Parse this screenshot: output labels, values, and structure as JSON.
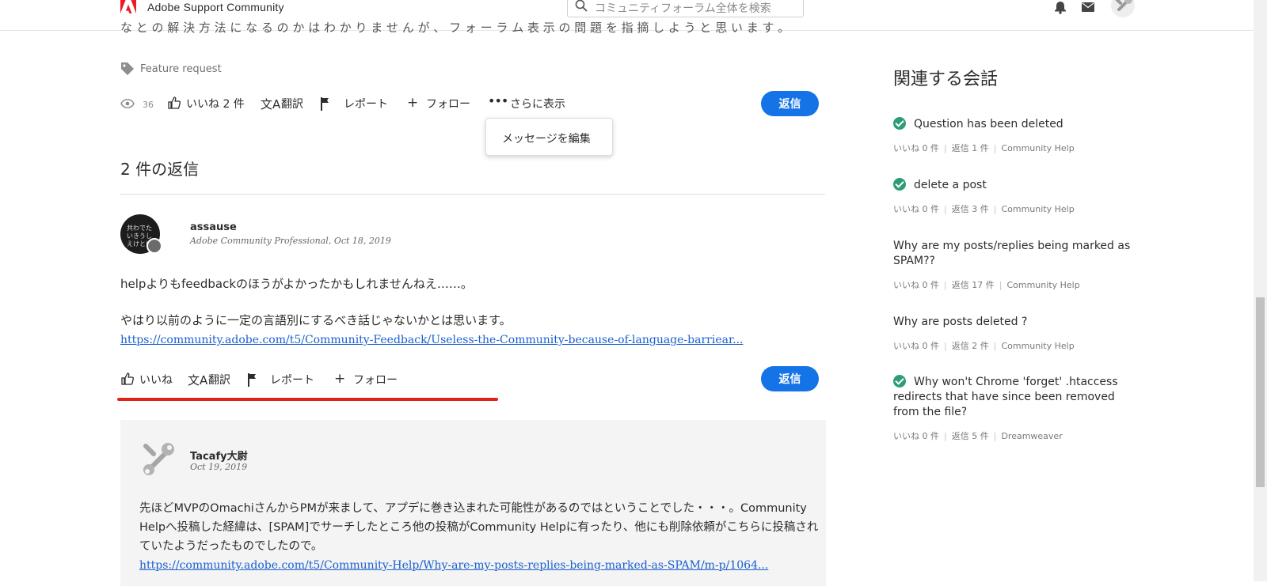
{
  "header": {
    "brand": "Adobe Support Community",
    "search_placeholder": "コミュニティフォーラム全体を検索"
  },
  "post": {
    "tag": "Feature request",
    "views": "36",
    "like_label": "いいね 2 件",
    "translate_label": "翻訳",
    "report_label": "レポート",
    "follow_label": "フォロー",
    "more_label": "さらに表示",
    "reply_label": "返信",
    "dropdown_edit": "メッセージを編集"
  },
  "replies_heading": "2 件の返信",
  "reply1": {
    "user": "assause",
    "meta": "Adobe Community Professional, Oct 18, 2019",
    "line1": "helpよりもfeedbackのほうがよかったかもしれませんねえ……。",
    "line2": "やはり以前のように一定の言語別にするべき話じゃないかとは思います。",
    "link": "https://community.adobe.com/t5/Community-Feedback/Useless-the-Community-because-of-language-barriear...",
    "like_label": "いいね",
    "translate_label": "翻訳",
    "report_label": "レポート",
    "follow_label": "フォロー",
    "reply_label": "返信"
  },
  "reply2": {
    "user": "Tacafy大尉",
    "meta": "Oct 19, 2019",
    "text": "先ほどMVPのOmachiさんからPMが来まして、アプデに巻き込まれた可能性があるのではということでした・・・。Community Helpへ投稿した経緯は、[SPAM]でサーチしたところ他の投稿がCommunity Helpに有ったり、他にも削除依頼がこちらに投稿されていたようだったものでしたので。",
    "link": "https://community.adobe.com/t5/Community-Help/Why-are-my-posts-replies-being-marked-as-SPAM/m-p/1064..."
  },
  "sidebar": {
    "heading": "関連する会話",
    "items": [
      {
        "title": "Question has been deleted",
        "solved": true,
        "likes": "いいね 0 件",
        "replies": "返信 1 件",
        "board": "Community Help"
      },
      {
        "title": "delete a post",
        "solved": true,
        "likes": "いいね 0 件",
        "replies": "返信 3 件",
        "board": "Community Help"
      },
      {
        "title": "Why are my posts/replies being marked as SPAM??",
        "solved": false,
        "likes": "いいね 0 件",
        "replies": "返信 17 件",
        "board": "Community Help"
      },
      {
        "title": "Why are posts deleted ?",
        "solved": false,
        "likes": "いいね 0 件",
        "replies": "返信 2 件",
        "board": "Community Help"
      },
      {
        "title": "Why won't Chrome 'forget' .htaccess redirects that have since been removed from the file?",
        "solved": true,
        "likes": "いいね 0 件",
        "replies": "返信 5 件",
        "board": "Dreamweaver"
      }
    ]
  },
  "colors": {
    "accent": "#1473e6",
    "highlight": "#e2231a",
    "solved": "#2d9d78"
  }
}
